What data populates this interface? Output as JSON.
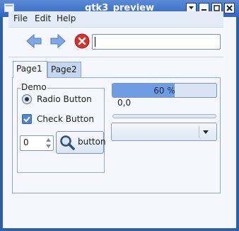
{
  "window": {
    "title": "gtk3_preview"
  },
  "titlebar_buttons": {
    "menu": "▾",
    "minimize": "–",
    "maximize": "□",
    "close": "×"
  },
  "menubar": {
    "items": [
      "File",
      "Edit",
      "Help"
    ]
  },
  "toolbar": {
    "back_icon": "arrow-left-icon",
    "forward_icon": "arrow-right-icon",
    "stop_icon": "stop-icon",
    "url_value": ""
  },
  "tabs": [
    {
      "label": "Page1",
      "active": true
    },
    {
      "label": "Page2",
      "active": false
    }
  ],
  "demo": {
    "frame_label": "Demo",
    "radio_label": "Radio Button",
    "radio_checked": true,
    "check_label": "Check Button",
    "check_checked": true,
    "spin_value": "0",
    "button_label": "button",
    "button_icon": "magnifier-icon"
  },
  "progress": {
    "value": 0.6,
    "text": "60 %"
  },
  "coords": "0,0",
  "slider": {
    "value": 0
  },
  "combo": {
    "value": ""
  },
  "colors": {
    "accent": "#6f9de3",
    "titlebar": "#2e66c3",
    "stop": "#d9302c"
  }
}
